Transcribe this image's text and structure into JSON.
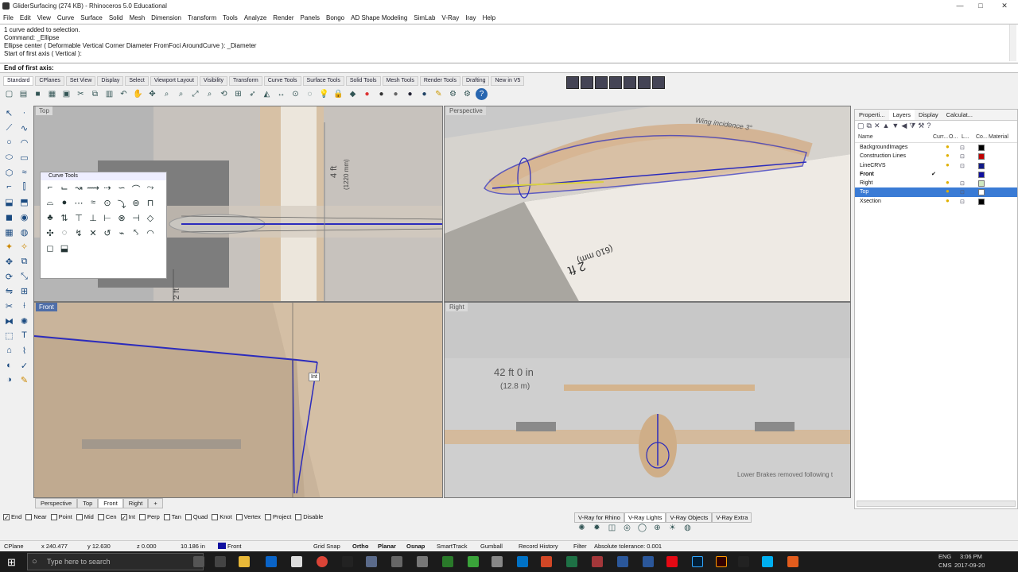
{
  "window": {
    "title": "GliderSurfacing (274 KB) - Rhinoceros 5.0 Educational",
    "minimize": "—",
    "maximize": "□",
    "close": "✕"
  },
  "menu": [
    "File",
    "Edit",
    "View",
    "Curve",
    "Surface",
    "Solid",
    "Mesh",
    "Dimension",
    "Transform",
    "Tools",
    "Analyze",
    "Render",
    "Panels",
    "Bongo",
    "AD Shape Modeling",
    "SimLab",
    "V-Ray",
    "Iray",
    "Help"
  ],
  "command_history": [
    "1 curve added to selection.",
    "Command: _Ellipse",
    "Ellipse center ( Deformable  Vertical  Corner  Diameter  FromFoci  AroundCurve ): _Diameter",
    "Start of first axis ( Vertical ):"
  ],
  "command_prompt": "End of first axis:",
  "toolbar_tabs": [
    "Standard",
    "CPlanes",
    "Set View",
    "Display",
    "Select",
    "Viewport Layout",
    "Visibility",
    "Transform",
    "Curve Tools",
    "Surface Tools",
    "Solid Tools",
    "Mesh Tools",
    "Render Tools",
    "Drafting",
    "New in V5"
  ],
  "active_toolbar_tab": "Standard",
  "viewports": {
    "top": "Top",
    "perspective": "Perspective",
    "front": "Front",
    "right": "Right"
  },
  "floating_palette": {
    "title": "Curve Tools"
  },
  "viewport_annotations": {
    "top_dim": "4 ft",
    "top_dim2": "(1220 mm)",
    "top_dim3": "2 ft",
    "persp_text": "Wing incidence 3°",
    "persp_dim": "2 ft",
    "persp_dim2": "(610 mm)",
    "right_dim": "42 ft 0 in",
    "right_dim2": "(12.8 m)",
    "right_note": "Lower Brakes removed following t",
    "osnap_tip": "Int"
  },
  "viewport_tabs": [
    "Perspective",
    "Top",
    "Front",
    "Right"
  ],
  "active_viewport_tab": "Front",
  "panel": {
    "tabs": [
      "Properti...",
      "Layers",
      "Display",
      "Calculat..."
    ],
    "columns": [
      "Name",
      "Curr...",
      "O...",
      "L...",
      "Co...",
      "Material"
    ],
    "layers": [
      {
        "name": "BackgroundImages",
        "color": "#000000",
        "current": false
      },
      {
        "name": "Construction Lines",
        "color": "#c00000",
        "current": false
      },
      {
        "name": "LineCRVS",
        "color": "#111a88",
        "current": false
      },
      {
        "name": "Front",
        "color": "#1010a0",
        "current": true
      },
      {
        "name": "Right",
        "color": "#cfe8c0",
        "current": false
      },
      {
        "name": "Top",
        "color": "#ffffff",
        "current": false
      },
      {
        "name": "Xsection",
        "color": "#000000",
        "current": false
      }
    ],
    "current_mark": "✔",
    "selected_layer": "Top"
  },
  "vray_tabs": [
    "V-Ray for Rhino",
    "V-Ray Lights",
    "V-Ray Objects",
    "V-Ray Extra"
  ],
  "osnaps": [
    {
      "label": "End",
      "on": true
    },
    {
      "label": "Near",
      "on": false
    },
    {
      "label": "Point",
      "on": false
    },
    {
      "label": "Mid",
      "on": false
    },
    {
      "label": "Cen",
      "on": false
    },
    {
      "label": "Int",
      "on": true
    },
    {
      "label": "Perp",
      "on": false
    },
    {
      "label": "Tan",
      "on": false
    },
    {
      "label": "Quad",
      "on": false
    },
    {
      "label": "Knot",
      "on": false
    },
    {
      "label": "Vertex",
      "on": false
    },
    {
      "label": "Project",
      "on": false
    },
    {
      "label": "Disable",
      "on": false
    }
  ],
  "status": {
    "cplane": "CPlane",
    "x": "x 240.477",
    "y": "y 12.630",
    "z": "z 0.000",
    "dist": "10.186 in",
    "layer": "Front",
    "grid_snap": "Grid Snap",
    "ortho": "Ortho",
    "planar": "Planar",
    "osnap": "Osnap",
    "smarttrack": "SmartTrack",
    "gumball": "Gumball",
    "record_history": "Record History",
    "filter": "Filter",
    "tolerance": "Absolute tolerance: 0.001"
  },
  "taskbar": {
    "search_placeholder": "Type here to search",
    "lang": "ENG",
    "lang2": "CMS",
    "time": "3:06 PM",
    "date": "2017-09-20"
  }
}
